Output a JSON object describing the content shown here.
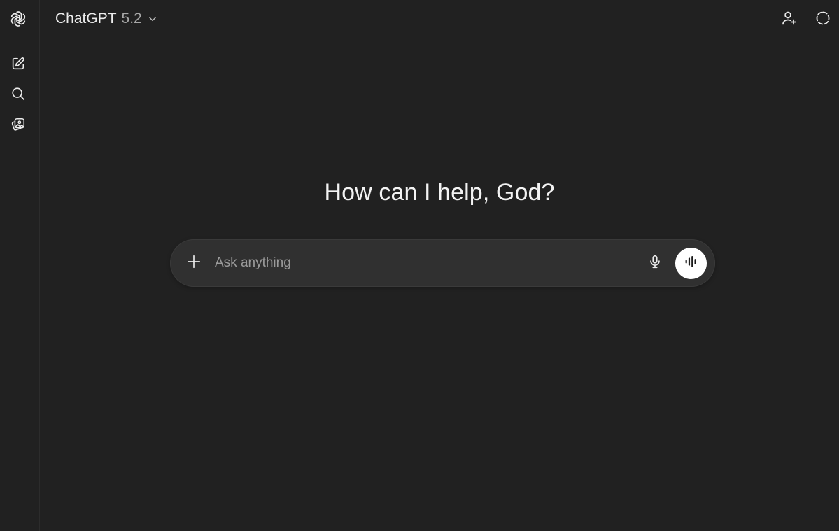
{
  "app": {
    "logo_icon": "openai-logo-icon"
  },
  "sidebar": {
    "items": [
      {
        "icon": "new-chat-icon",
        "label": "New chat"
      },
      {
        "icon": "search-icon",
        "label": "Search chats"
      },
      {
        "icon": "images-icon",
        "label": "Images"
      }
    ]
  },
  "header": {
    "model_name": "ChatGPT",
    "model_version": "5.2",
    "chevron_icon": "chevron-down-icon",
    "actions": [
      {
        "icon": "add-person-icon"
      },
      {
        "icon": "temporary-chat-icon"
      }
    ]
  },
  "main": {
    "greeting": "How can I help, God?"
  },
  "composer": {
    "placeholder": "Ask anything",
    "value": "",
    "plus_icon": "plus-icon",
    "mic_icon": "microphone-icon",
    "voice_icon": "voice-mode-icon"
  },
  "colors": {
    "background": "#212121",
    "composer_bg": "#303030",
    "text_primary": "#ececec",
    "text_secondary": "#a8a8a8",
    "voice_button_bg": "#ffffff"
  }
}
